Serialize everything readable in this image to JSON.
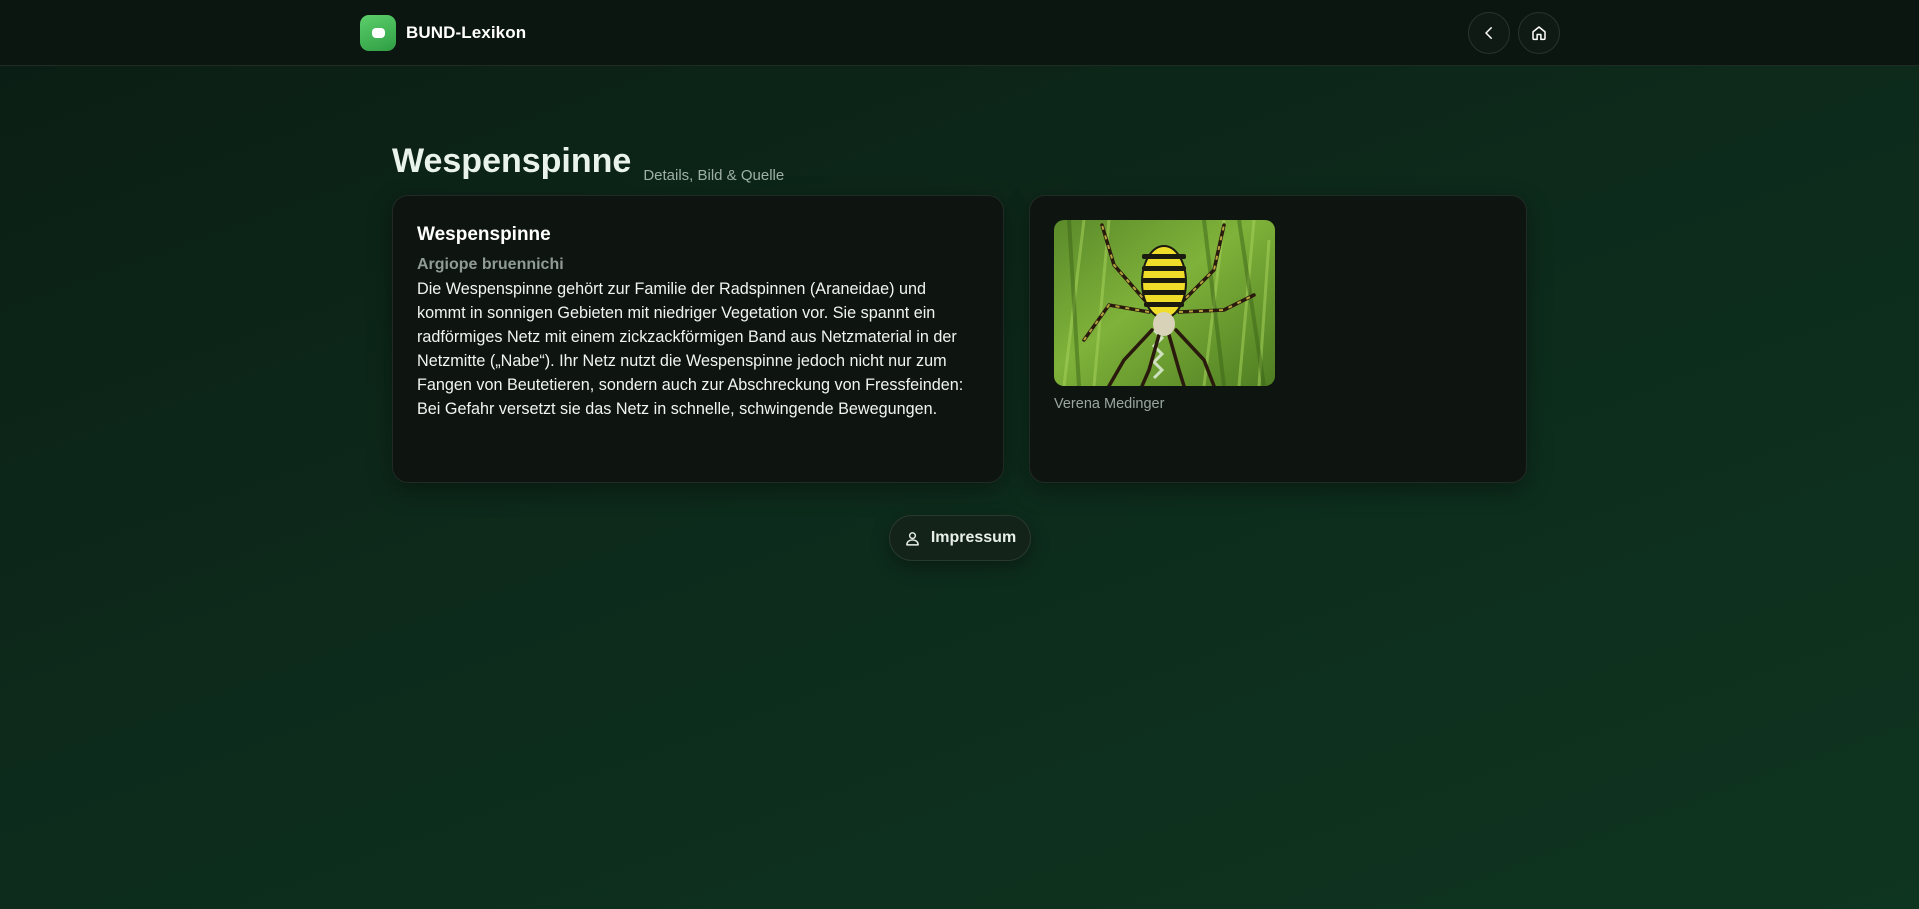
{
  "header": {
    "brand_name": "BUND-Lexikon",
    "back_icon": "chevron-left-icon",
    "home_icon": "home-icon"
  },
  "page": {
    "title": "Wespenspinne",
    "subtitle": "Details, Bild & Quelle"
  },
  "entry": {
    "name": "Wespenspinne",
    "latin_name": "Argiope bruennichi",
    "description": "Die Wespenspinne gehört zur Familie der Radspinnen (Araneidae) und kommt in sonnigen Gebieten mit niedriger Vegetation vor. Sie spannt ein radförmiges Netz mit einem zickzackförmigen Band aus Netzmaterial in der Netzmitte („Nabe“). Ihr Netz nutzt die Wespenspinne jedoch nicht nur zum Fangen von Beutetieren, sondern auch zur Abschreckung von Fressfeinden: Bei Gefahr versetzt sie das Netz in schnelle, schwingende Bewegungen.",
    "image_credit": "Verena Medinger"
  },
  "footer": {
    "impressum_label": "Impressum",
    "impressum_icon": "user-icon"
  },
  "colors": {
    "accent_green": "#3fb04f",
    "background_dark": "#0b1d14",
    "card_background": "#0e1410"
  }
}
